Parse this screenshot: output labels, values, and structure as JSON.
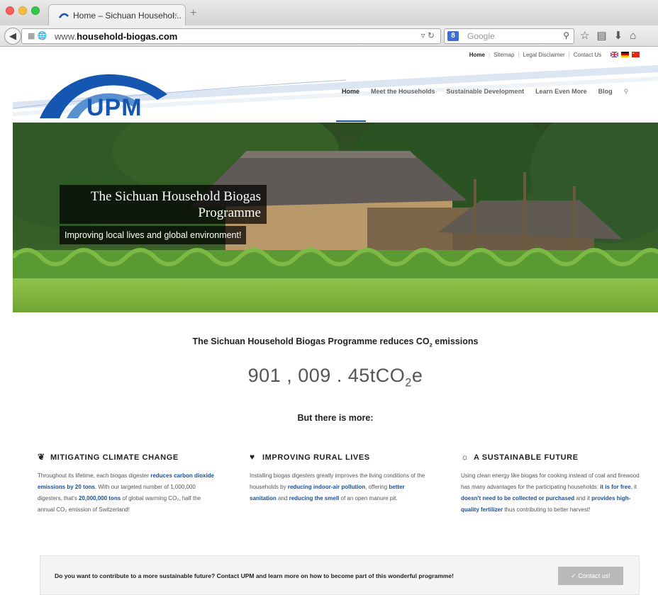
{
  "browser": {
    "tab_title": "Home – Sichuan Househol...",
    "tab_close": "×",
    "new_tab": "+",
    "url_prefix": "www.",
    "url_domain": "household-biogas.com",
    "search_placeholder": "Google",
    "search_engine_letter": "8"
  },
  "site": {
    "topbar": {
      "links": [
        "Home",
        "Sitemap",
        "Legal Disclaimer",
        "Contact Us"
      ]
    },
    "logo_text": "UPM",
    "nav": [
      "Home",
      "Meet the Households",
      "Sustainable Development",
      "Learn Even More",
      "Blog"
    ],
    "hero": {
      "title": "The Sichuan Household Biogas Programme",
      "subtitle": "Improving local lives and global environment!"
    },
    "lead_main": "The Sichuan Household Biogas Programme reduces CO",
    "lead_sub": "2",
    "lead_end": " emissions",
    "counter_value": "901 , 009 . 45tCO",
    "counter_sub": "2",
    "counter_end": "e",
    "more_heading": "But there is more:",
    "columns": [
      {
        "icon": "leaf-icon",
        "title": "MITIGATING CLIMATE CHANGE",
        "parts": [
          {
            "t": "Throughout its lifetime, each biogas digester "
          },
          {
            "t": "reduces carbon dioxide emissions by 20 tons",
            "hl": true
          },
          {
            "t": ". With our targeted number of 1,000,000 digesters, that's "
          },
          {
            "t": "20,000,000 tons",
            "hl": true
          },
          {
            "t": " of global warming CO₂, half the annual CO₂ emission of Switzerland!"
          }
        ]
      },
      {
        "icon": "heart-icon",
        "title": "IMPROVING RURAL LIVES",
        "parts": [
          {
            "t": "Installing biogas digesters greatly improves the living conditions of the households by "
          },
          {
            "t": "reducing indoor-air pollution",
            "hl": true
          },
          {
            "t": ", offering "
          },
          {
            "t": "better sanitation",
            "hl": true
          },
          {
            "t": " and "
          },
          {
            "t": "reducing the smell",
            "hl": true
          },
          {
            "t": " of an open manure pit."
          }
        ]
      },
      {
        "icon": "sun-icon",
        "title": "A SUSTAINABLE FUTURE",
        "parts": [
          {
            "t": "Using clean energy like biogas for cooking instead of coal and firewood has many advantages for the participating households: "
          },
          {
            "t": "it is for free",
            "hl": true
          },
          {
            "t": ", it "
          },
          {
            "t": "doesn't need to be collected or purchased",
            "hl": true
          },
          {
            "t": " and it "
          },
          {
            "t": "provides high-quality fertilizer",
            "hl": true
          },
          {
            "t": " thus contributing to better harvest!"
          }
        ]
      }
    ],
    "cta": {
      "text": "Do you want to contribute to a more sustainable future? Contact UPM and learn more on how to become part of this wonderful programme!",
      "button": "✓ Contact us!"
    },
    "colors": {
      "brand_blue": "#1557b0",
      "highlight_blue": "#1a4f9a"
    }
  }
}
